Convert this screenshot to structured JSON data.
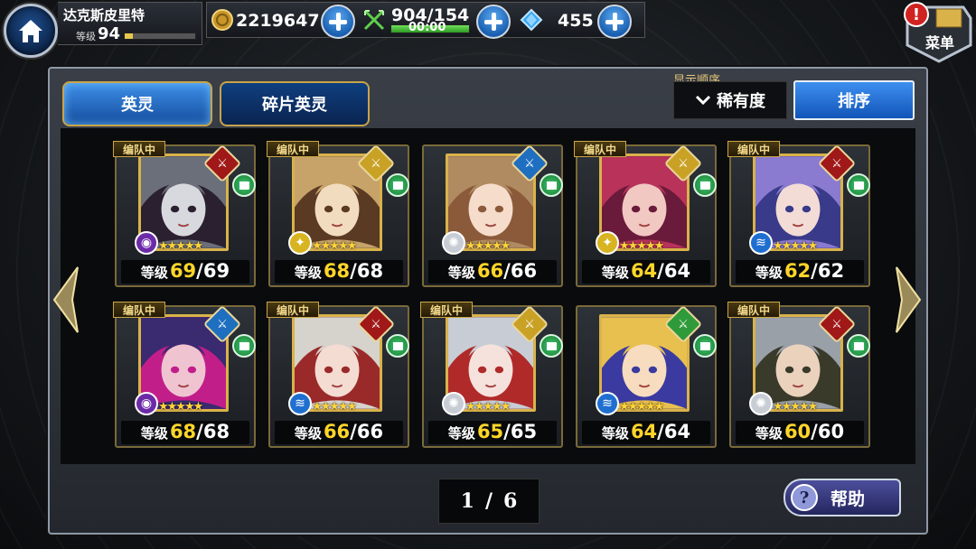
{
  "hud": {
    "player_name": "达克斯皮里特",
    "level_label": "等级",
    "level": "94",
    "exp_fraction": 0.12,
    "gold": "2219647",
    "stamina": "904/154",
    "stamina_timer": "00:00",
    "stamina_fraction": 1.0,
    "crystals": "455",
    "menu_label": "菜单",
    "menu_badge": "!"
  },
  "tabs": [
    {
      "label": "英灵",
      "active": true
    },
    {
      "label": "碎片英灵",
      "active": false
    }
  ],
  "sort": {
    "caption": "显示顺序",
    "value": "稀有度",
    "button_label": "排序"
  },
  "card_common": {
    "formation_tag": "编队中",
    "level_label": "等级"
  },
  "heroes": [
    {
      "in_formation": true,
      "level": "69",
      "max_level": "69",
      "stars": 5,
      "element": "dark",
      "class_color": "#a01818",
      "portrait_palette": [
        "#6a6f7a",
        "#d8d9de",
        "#2a2030"
      ]
    },
    {
      "in_formation": true,
      "level": "68",
      "max_level": "68",
      "stars": 5,
      "element": "light",
      "class_color": "#c9a125",
      "portrait_palette": [
        "#c7a369",
        "#f2dcc0",
        "#5a3a22"
      ]
    },
    {
      "in_formation": false,
      "level": "66",
      "max_level": "66",
      "stars": 5,
      "element": "wind",
      "class_color": "#1e6fc0",
      "portrait_palette": [
        "#b08a60",
        "#f6dccb",
        "#8a5a3a"
      ]
    },
    {
      "in_formation": true,
      "level": "64",
      "max_level": "64",
      "stars": 5,
      "element": "light",
      "class_color": "#c9a125",
      "portrait_palette": [
        "#b8325a",
        "#f1c8c2",
        "#6a1a3a"
      ]
    },
    {
      "in_formation": true,
      "level": "62",
      "max_level": "62",
      "stars": 5,
      "element": "water",
      "class_color": "#a01818",
      "portrait_palette": [
        "#8a7ad0",
        "#f3dcd6",
        "#3a3a8a"
      ]
    },
    {
      "in_formation": true,
      "level": "68",
      "max_level": "68",
      "stars": 5,
      "element": "dark",
      "class_color": "#1e6fc0",
      "portrait_palette": [
        "#3a2a70",
        "#efc4d0",
        "#c21e8a"
      ]
    },
    {
      "in_formation": true,
      "level": "66",
      "max_level": "66",
      "stars": 5,
      "element": "water",
      "class_color": "#a01818",
      "portrait_palette": [
        "#d6d2cc",
        "#f4dcd2",
        "#9a2a2a"
      ]
    },
    {
      "in_formation": true,
      "level": "65",
      "max_level": "65",
      "stars": 5,
      "element": "wind",
      "class_color": "#c9a125",
      "portrait_palette": [
        "#c8ccd4",
        "#f6e2dc",
        "#b02a2a"
      ]
    },
    {
      "in_formation": false,
      "level": "64",
      "max_level": "64",
      "stars": 5,
      "element": "water",
      "class_color": "#2f9a3a",
      "portrait_palette": [
        "#e8c050",
        "#f8dcc0",
        "#3a3aa0"
      ]
    },
    {
      "in_formation": true,
      "level": "60",
      "max_level": "60",
      "stars": 5,
      "element": "wind",
      "class_color": "#a01818",
      "portrait_palette": [
        "#9aa0a8",
        "#ead2bc",
        "#3a3a2a"
      ]
    }
  ],
  "pagination": {
    "current": "1",
    "separator": "/",
    "total": "6"
  },
  "help_label": "帮助",
  "colors": {
    "level_current": "#ffd628",
    "dark": "#6c2aa8",
    "light": "#d8b420",
    "wind": "#c8ccd4",
    "water": "#1f6fd0"
  }
}
